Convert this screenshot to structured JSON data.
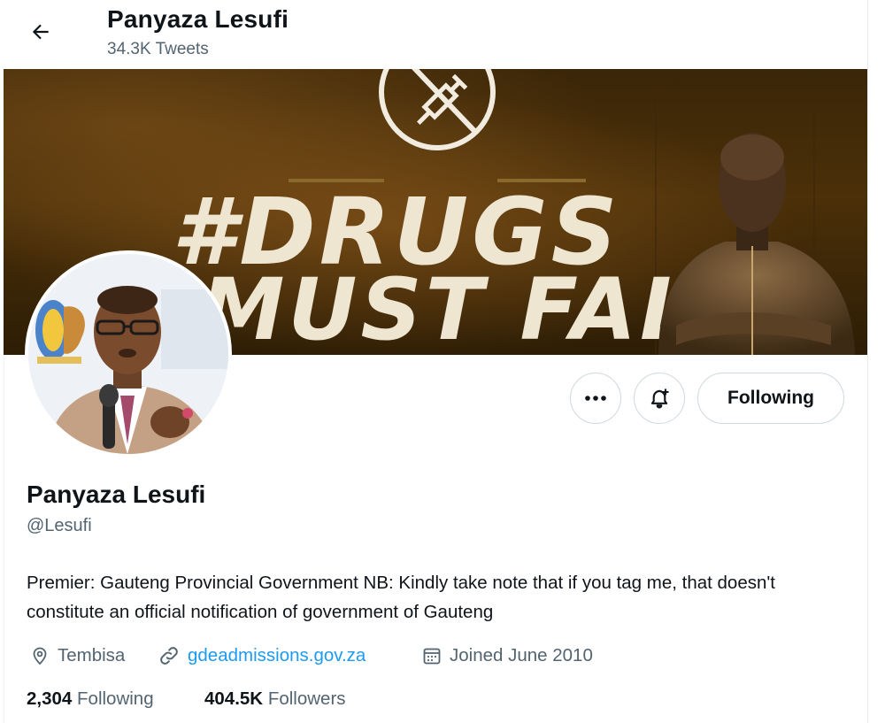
{
  "header": {
    "name": "Panyaza Lesufi",
    "tweet_count": "34.3K Tweets"
  },
  "banner": {
    "line1": "#DRUGS",
    "line2": "MUST FALL",
    "colors": {
      "bg_dark": "#2d1d05",
      "text": "#efe6d2"
    }
  },
  "actions": {
    "following_label": "Following"
  },
  "profile": {
    "name": "Panyaza Lesufi",
    "handle": "@Lesufi",
    "bio": "Premier: Gauteng Provincial Government NB: Kindly take note that if you tag me, that doesn't constitute an official notification of government of Gauteng",
    "location": "Tembisa",
    "website": "gdeadmissions.gov.za",
    "joined": "Joined June 2010",
    "following_count": "2,304",
    "following_label": "Following",
    "followers_count": "404.5K",
    "followers_label": "Followers"
  },
  "colors": {
    "link": "#1d9bf0",
    "secondary": "#536471",
    "primary": "#0f1419"
  }
}
